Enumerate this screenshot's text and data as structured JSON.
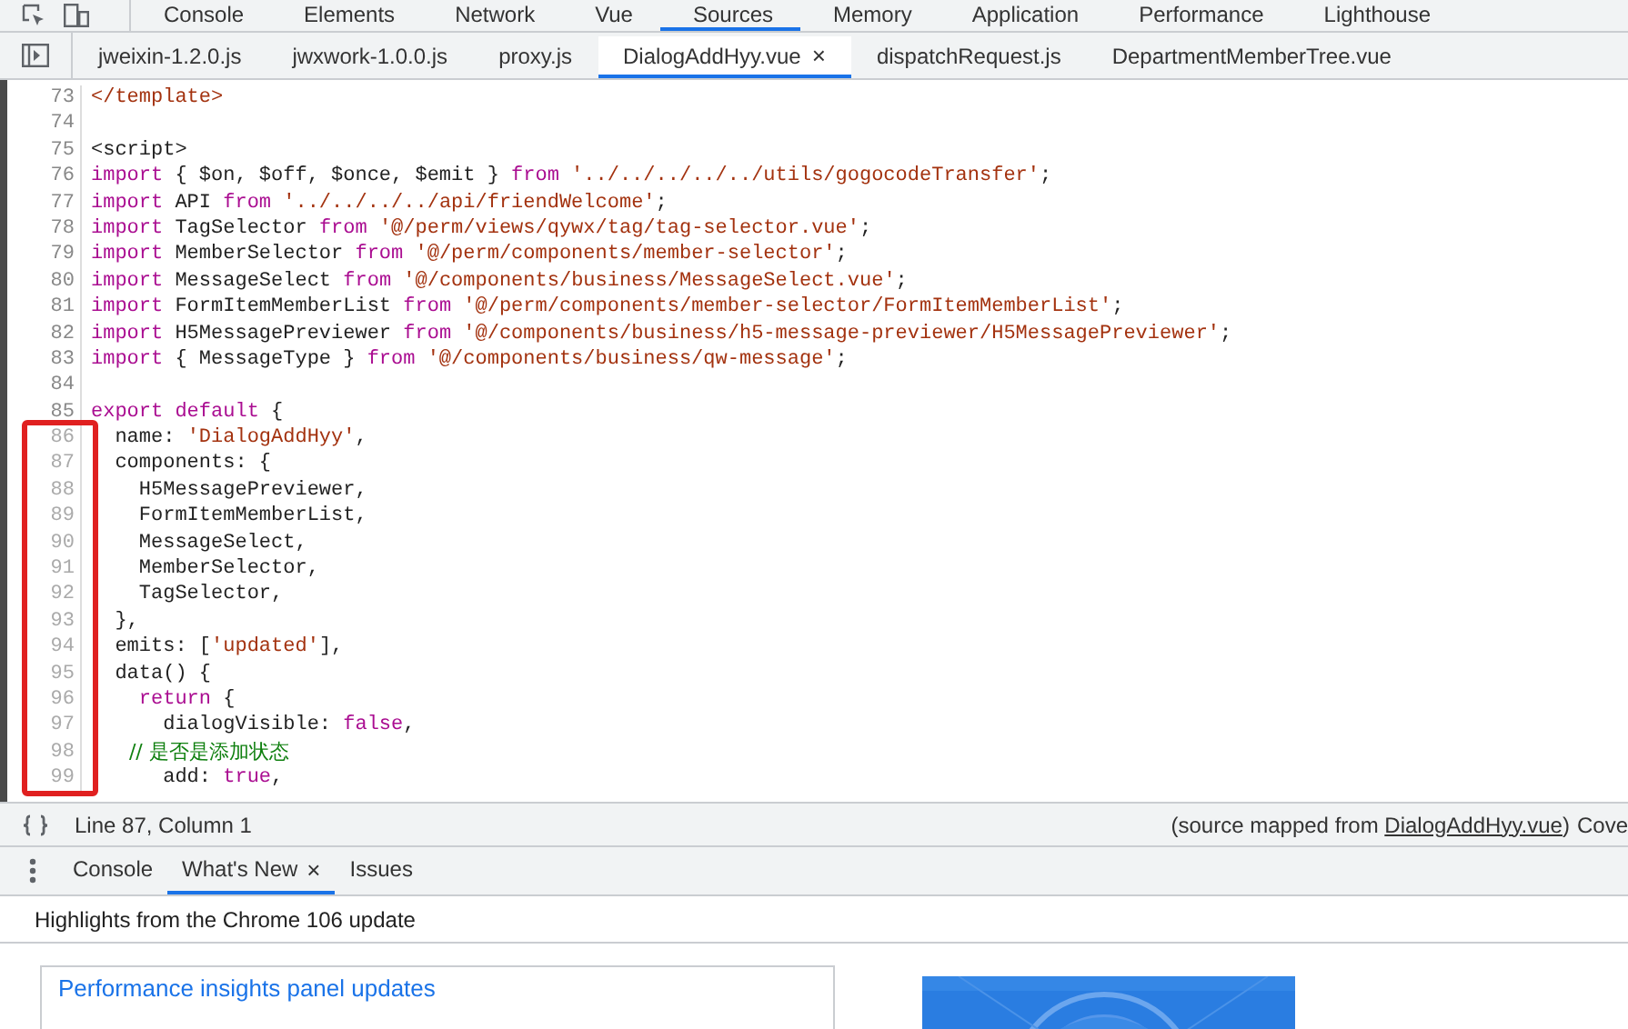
{
  "panel_tabs": [
    {
      "label": "Console",
      "selected": false
    },
    {
      "label": "Elements",
      "selected": false
    },
    {
      "label": "Network",
      "selected": false
    },
    {
      "label": "Vue",
      "selected": false
    },
    {
      "label": "Sources",
      "selected": true
    },
    {
      "label": "Memory",
      "selected": false
    },
    {
      "label": "Application",
      "selected": false
    },
    {
      "label": "Performance",
      "selected": false
    },
    {
      "label": "Lighthouse",
      "selected": false
    }
  ],
  "file_tabs": [
    {
      "label": "jweixin-1.2.0.js",
      "selected": false
    },
    {
      "label": "jwxwork-1.0.0.js",
      "selected": false
    },
    {
      "label": "proxy.js",
      "selected": false
    },
    {
      "label": "DialogAddHyy.vue",
      "selected": true,
      "close": "×"
    },
    {
      "label": "dispatchRequest.js",
      "selected": false
    },
    {
      "label": "DepartmentMemberTree.vue",
      "selected": false
    }
  ],
  "editor": {
    "lines": [
      {
        "number": "73",
        "framed": false,
        "tokens": [
          {
            "kind": "tag",
            "text": "</template>"
          }
        ]
      },
      {
        "number": "74",
        "framed": false
      },
      {
        "number": "75",
        "framed": false,
        "tokens": [
          {
            "kind": "plain",
            "text": "<script>"
          }
        ]
      },
      {
        "number": "76",
        "framed": false,
        "tokens": [
          {
            "kind": "keyword",
            "text": "import"
          },
          {
            "kind": "plain",
            "text": " { $on, $off, $once, $emit } "
          },
          {
            "kind": "keyword",
            "text": "from"
          },
          {
            "kind": "string",
            "text": " '../../../../../utils/gogocodeTransfer'"
          },
          {
            "kind": "plain",
            "text": ";"
          }
        ]
      },
      {
        "number": "77",
        "framed": false,
        "tokens": [
          {
            "kind": "keyword",
            "text": "import"
          },
          {
            "kind": "plain",
            "text": " API "
          },
          {
            "kind": "keyword",
            "text": "from"
          },
          {
            "kind": "string",
            "text": " '../../../../api/friendWelcome'"
          },
          {
            "kind": "plain",
            "text": ";"
          }
        ]
      },
      {
        "number": "78",
        "framed": false,
        "tokens": [
          {
            "kind": "keyword",
            "text": "import"
          },
          {
            "kind": "plain",
            "text": " TagSelector "
          },
          {
            "kind": "keyword",
            "text": "from"
          },
          {
            "kind": "string",
            "text": " '@/perm/views/qywx/tag/tag-selector.vue'"
          },
          {
            "kind": "plain",
            "text": ";"
          }
        ]
      },
      {
        "number": "79",
        "framed": false,
        "tokens": [
          {
            "kind": "keyword",
            "text": "import"
          },
          {
            "kind": "plain",
            "text": " MemberSelector "
          },
          {
            "kind": "keyword",
            "text": "from"
          },
          {
            "kind": "string",
            "text": " '@/perm/components/member-selector'"
          },
          {
            "kind": "plain",
            "text": ";"
          }
        ]
      },
      {
        "number": "80",
        "framed": false,
        "tokens": [
          {
            "kind": "keyword",
            "text": "import"
          },
          {
            "kind": "plain",
            "text": " MessageSelect "
          },
          {
            "kind": "keyword",
            "text": "from"
          },
          {
            "kind": "string",
            "text": " '@/components/business/MessageSelect.vue'"
          },
          {
            "kind": "plain",
            "text": ";"
          }
        ]
      },
      {
        "number": "81",
        "framed": false,
        "tokens": [
          {
            "kind": "keyword",
            "text": "import"
          },
          {
            "kind": "plain",
            "text": " FormItemMemberList "
          },
          {
            "kind": "keyword",
            "text": "from"
          },
          {
            "kind": "string",
            "text": " '@/perm/components/member-selector/FormItemMemberList'"
          },
          {
            "kind": "plain",
            "text": ";"
          }
        ]
      },
      {
        "number": "82",
        "framed": false,
        "tokens": [
          {
            "kind": "keyword",
            "text": "import"
          },
          {
            "kind": "plain",
            "text": " H5MessagePreviewer "
          },
          {
            "kind": "keyword",
            "text": "from"
          },
          {
            "kind": "string",
            "text": " '@/components/business/h5-message-previewer/H5MessagePreviewer'"
          },
          {
            "kind": "plain",
            "text": ";"
          }
        ]
      },
      {
        "number": "83",
        "framed": false,
        "tokens": [
          {
            "kind": "keyword",
            "text": "import"
          },
          {
            "kind": "plain",
            "text": " { MessageType } "
          },
          {
            "kind": "keyword",
            "text": "from"
          },
          {
            "kind": "string",
            "text": " '@/components/business/qw-message'"
          },
          {
            "kind": "plain",
            "text": ";"
          }
        ]
      },
      {
        "number": "84",
        "framed": false
      },
      {
        "number": "85",
        "framed": false,
        "tokens": [
          {
            "kind": "keyword",
            "text": "export default"
          },
          {
            "kind": "plain",
            "text": " {"
          }
        ]
      },
      {
        "number": "86",
        "framed": true,
        "tokens": [
          {
            "kind": "plain",
            "text": "  name: "
          },
          {
            "kind": "string",
            "text": "'DialogAddHyy'"
          },
          {
            "kind": "plain",
            "text": ","
          }
        ]
      },
      {
        "number": "87",
        "framed": true,
        "tokens": [
          {
            "kind": "plain",
            "text": "  components: {"
          }
        ]
      },
      {
        "number": "88",
        "framed": true,
        "tokens": [
          {
            "kind": "plain",
            "text": "    H5MessagePreviewer,"
          }
        ]
      },
      {
        "number": "89",
        "framed": true,
        "tokens": [
          {
            "kind": "plain",
            "text": "    FormItemMemberList,"
          }
        ]
      },
      {
        "number": "90",
        "framed": true,
        "tokens": [
          {
            "kind": "plain",
            "text": "    MessageSelect,"
          }
        ]
      },
      {
        "number": "91",
        "framed": true,
        "tokens": [
          {
            "kind": "plain",
            "text": "    MemberSelector,"
          }
        ]
      },
      {
        "number": "92",
        "framed": true,
        "tokens": [
          {
            "kind": "plain",
            "text": "    TagSelector,"
          }
        ]
      },
      {
        "number": "93",
        "framed": true,
        "tokens": [
          {
            "kind": "plain",
            "text": "  },"
          }
        ]
      },
      {
        "number": "94",
        "framed": true,
        "tokens": [
          {
            "kind": "plain",
            "text": "  emits: ["
          },
          {
            "kind": "string",
            "text": "'updated'"
          },
          {
            "kind": "plain",
            "text": "],"
          }
        ]
      },
      {
        "number": "95",
        "framed": true,
        "tokens": [
          {
            "kind": "plain",
            "text": "  data() {"
          }
        ]
      },
      {
        "number": "96",
        "framed": true,
        "tokens": [
          {
            "kind": "keyword",
            "text": "    return"
          },
          {
            "kind": "plain",
            "text": " {"
          }
        ]
      },
      {
        "number": "97",
        "framed": true,
        "tokens": [
          {
            "kind": "plain",
            "text": "      dialogVisible: "
          },
          {
            "kind": "keyword",
            "text": "false"
          },
          {
            "kind": "plain",
            "text": ","
          }
        ]
      },
      {
        "number": "98",
        "framed": true,
        "tokens": [
          {
            "kind": "comment",
            "text": "      // 是否是添加状态"
          }
        ]
      },
      {
        "number": "99",
        "framed": true,
        "tokens": [
          {
            "kind": "plain",
            "text": "      add: "
          },
          {
            "kind": "keyword",
            "text": "true"
          },
          {
            "kind": "plain",
            "text": ","
          }
        ]
      }
    ]
  },
  "status_bar": {
    "position": "Line 87, Column 1",
    "source_prefix": "(source mapped from ",
    "source_link": "DialogAddHyy.vue",
    "source_suffix": ")",
    "coverage": "Cove"
  },
  "drawer_tabs": [
    {
      "label": "Console",
      "selected": false
    },
    {
      "label": "What's New",
      "selected": true,
      "close": "×"
    },
    {
      "label": "Issues",
      "selected": false
    }
  ],
  "whats_new": {
    "heading": "Highlights from the Chrome 106 update",
    "cards": [
      {
        "title": "Performance insights panel updates"
      }
    ]
  }
}
